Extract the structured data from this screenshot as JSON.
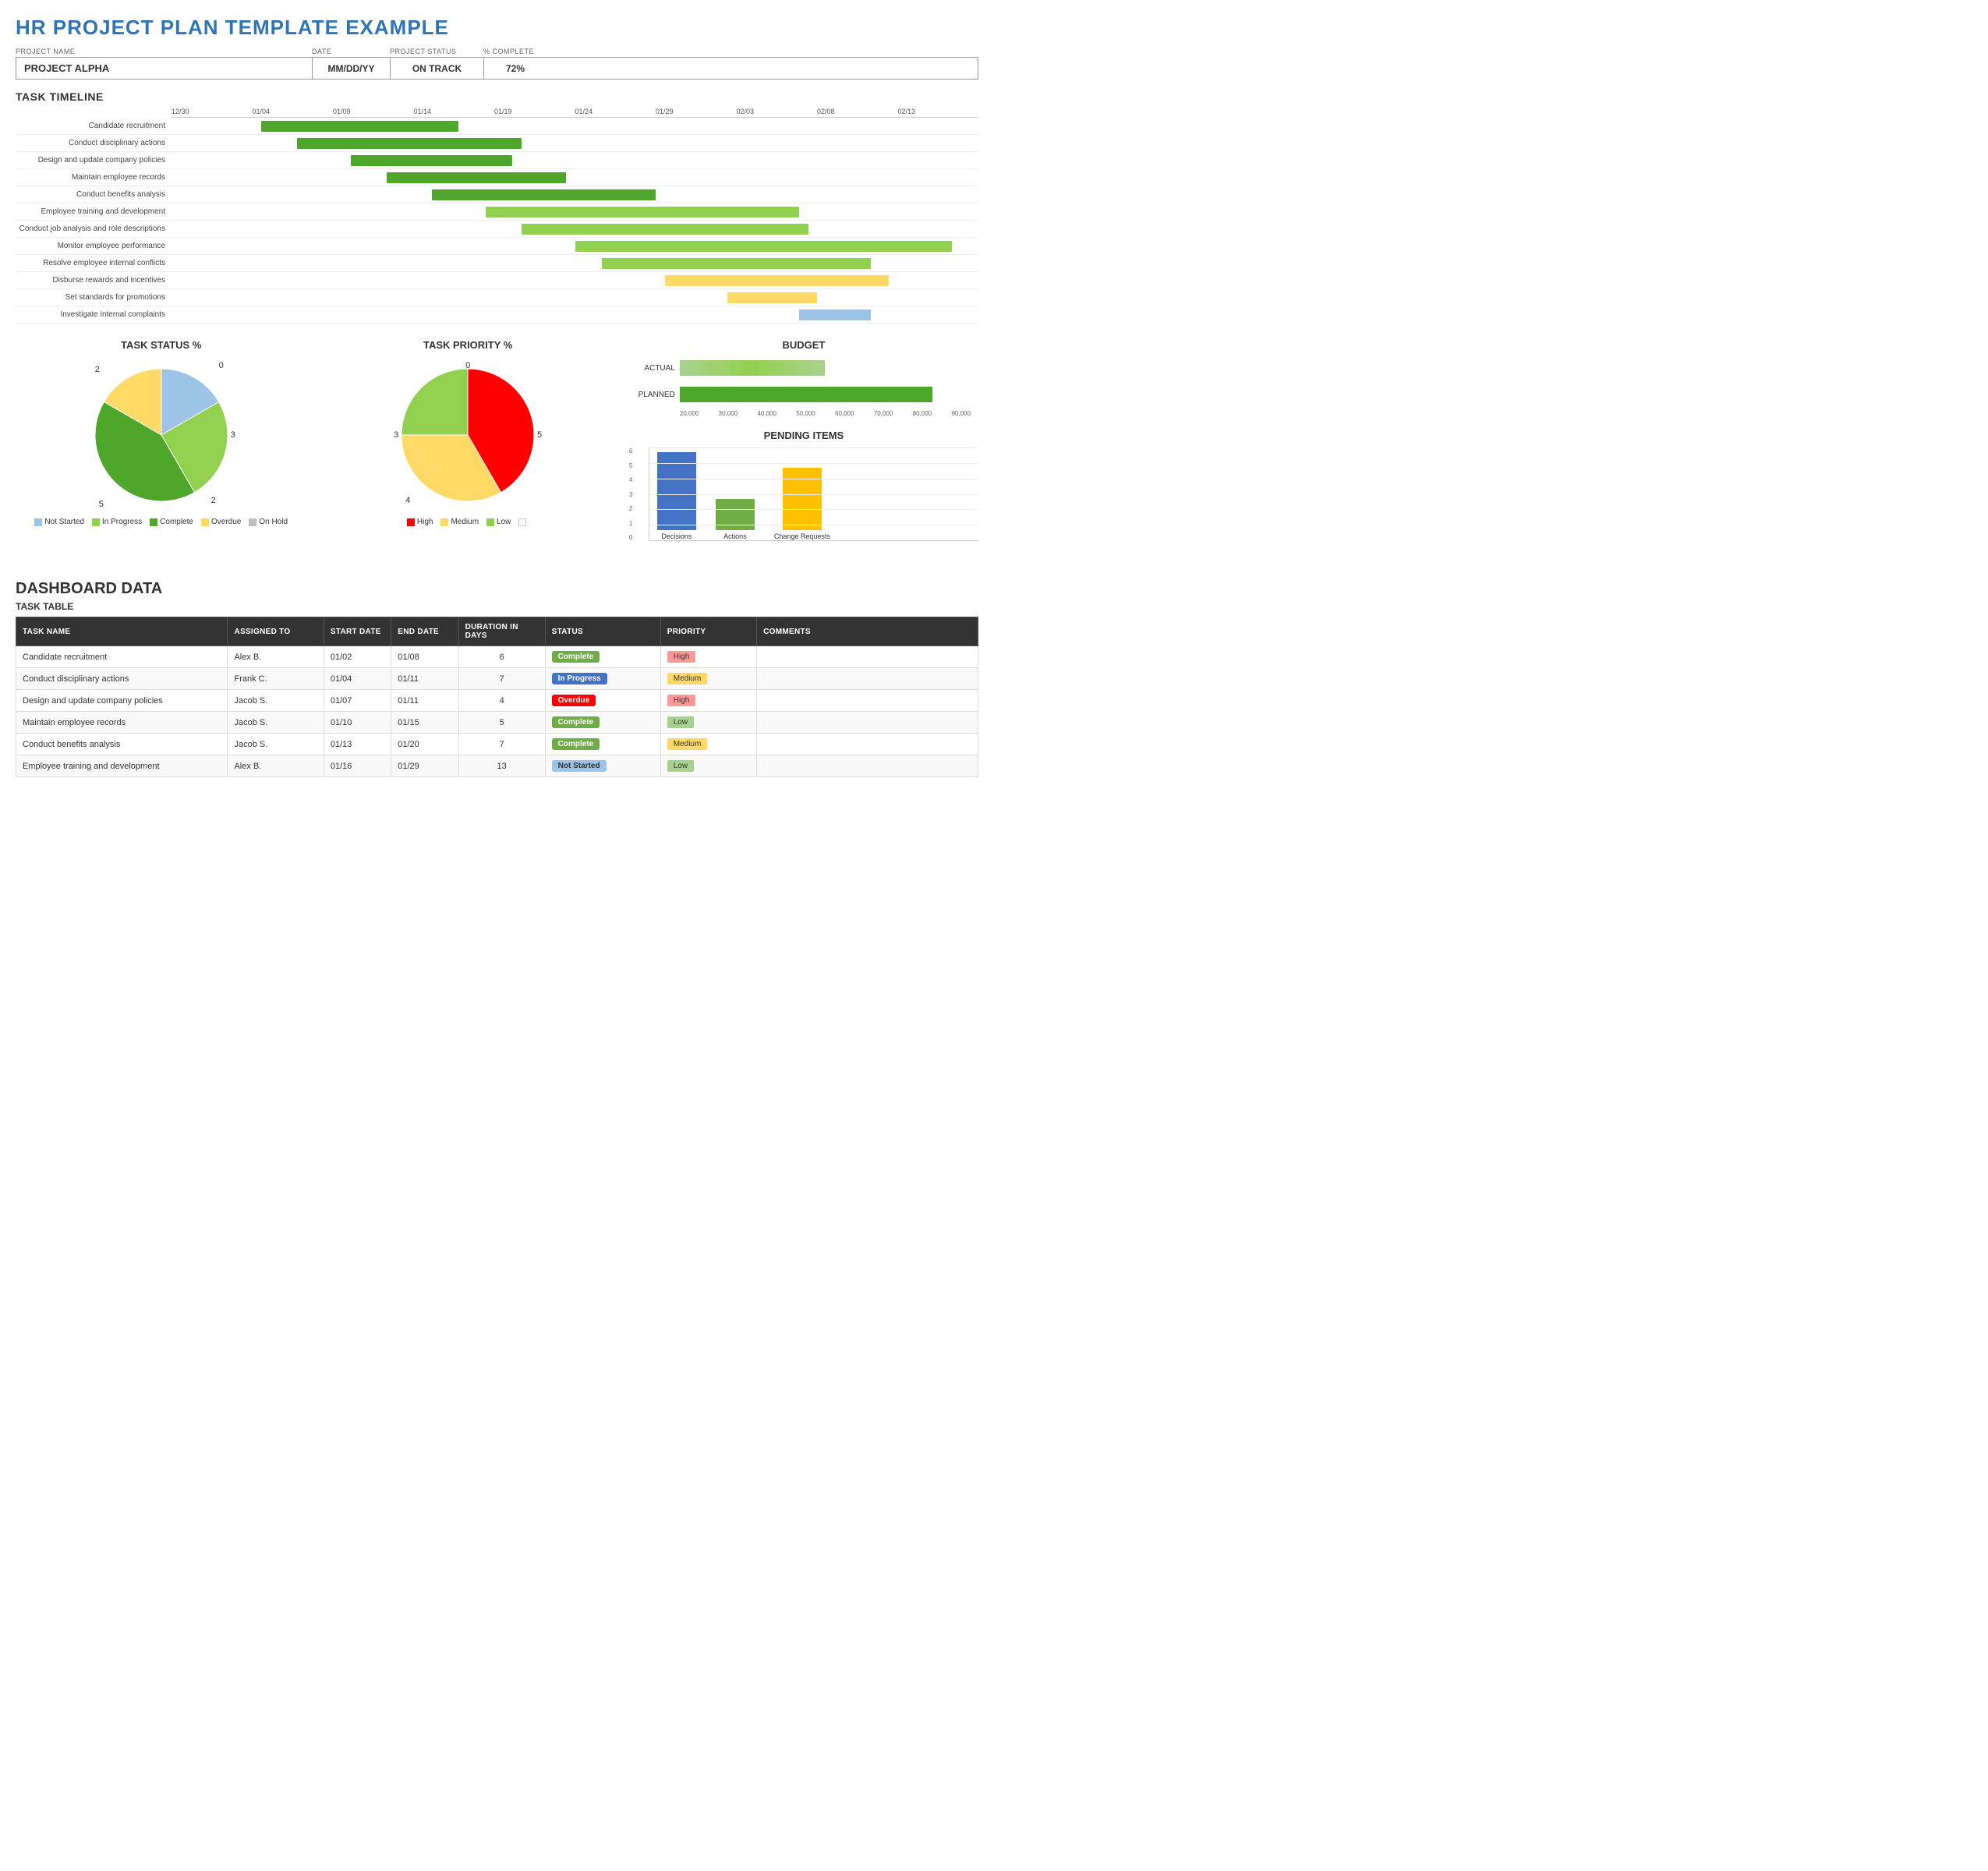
{
  "title": "HR PROJECT PLAN TEMPLATE EXAMPLE",
  "project": {
    "name_label": "PROJECT NAME",
    "date_label": "DATE",
    "status_label": "PROJECT STATUS",
    "complete_label": "% COMPLETE",
    "name_value": "PROJECT ALPHA",
    "date_value": "MM/DD/YY",
    "status_value": "ON TRACK",
    "complete_value": "72%"
  },
  "gantt": {
    "section_title": "TASK TIMELINE",
    "dates": [
      "12/30",
      "01/04",
      "01/09",
      "01/14",
      "01/19",
      "01/24",
      "01/29",
      "02/03",
      "02/08",
      "02/13"
    ],
    "tasks": [
      {
        "name": "Candidate recruitment",
        "start": 1,
        "width": 2.2,
        "color": "#4EA72A"
      },
      {
        "name": "Conduct disciplinary actions",
        "start": 1.4,
        "width": 2.5,
        "color": "#4EA72A"
      },
      {
        "name": "Design and update company policies",
        "start": 2.0,
        "width": 1.8,
        "color": "#4EA72A"
      },
      {
        "name": "Maintain employee records",
        "start": 2.4,
        "width": 2.0,
        "color": "#4EA72A"
      },
      {
        "name": "Conduct benefits analysis",
        "start": 2.9,
        "width": 2.5,
        "color": "#4EA72A"
      },
      {
        "name": "Employee training and development",
        "start": 3.5,
        "width": 3.5,
        "color": "#92D050"
      },
      {
        "name": "Conduct job analysis and role descriptions",
        "start": 3.9,
        "width": 3.2,
        "color": "#92D050"
      },
      {
        "name": "Monitor employee performance",
        "start": 4.5,
        "width": 4.2,
        "color": "#92D050"
      },
      {
        "name": "Resolve employee internal conflicts",
        "start": 4.8,
        "width": 3.0,
        "color": "#92D050"
      },
      {
        "name": "Disburse rewards and incentives",
        "start": 5.5,
        "width": 2.5,
        "color": "#FFD966"
      },
      {
        "name": "Set standards for promotions",
        "start": 6.2,
        "width": 1.0,
        "color": "#FFD966"
      },
      {
        "name": "Investigate internal complaints",
        "start": 7.0,
        "width": 0.8,
        "color": "#9DC3E6"
      }
    ]
  },
  "task_status": {
    "title": "TASK STATUS %",
    "slices": [
      {
        "label": "Not Started",
        "value": 2,
        "color": "#9DC3E6",
        "percent": 16.7
      },
      {
        "label": "In Progress",
        "value": 3,
        "color": "#92D050",
        "percent": 25
      },
      {
        "label": "Complete",
        "value": 5,
        "color": "#4EA72A",
        "percent": 41.7
      },
      {
        "label": "Overdue",
        "value": 2,
        "color": "#FFD966",
        "percent": 16.7
      },
      {
        "label": "On Hold",
        "value": 0,
        "color": "#BFBFBF",
        "percent": 0
      }
    ],
    "labels": {
      "not_started": "2",
      "in_progress": "3",
      "complete": "5",
      "overdue": "2",
      "on_hold": "0"
    }
  },
  "task_priority": {
    "title": "TASK PRIORITY %",
    "slices": [
      {
        "label": "High",
        "value": 5,
        "color": "#FF0000",
        "percent": 41.7
      },
      {
        "label": "Medium",
        "value": 4,
        "color": "#FFD966",
        "percent": 33.3
      },
      {
        "label": "Low",
        "value": 3,
        "color": "#92D050",
        "percent": 25
      },
      {
        "label": "blank",
        "value": 0,
        "color": "#FFFFFF",
        "percent": 0
      }
    ],
    "labels": {
      "high": "5",
      "medium": "4",
      "low": "3",
      "blank": "0"
    }
  },
  "budget": {
    "title": "BUDGET",
    "actual_label": "ACTUAL",
    "planned_label": "PLANNED",
    "actual_value": 45000,
    "planned_value": 78000,
    "max": 90000,
    "axis": [
      "20,000",
      "30,000",
      "40,000",
      "50,000",
      "60,000",
      "70,000",
      "80,000",
      "90,000"
    ]
  },
  "pending": {
    "title": "PENDING ITEMS",
    "items": [
      {
        "label": "Decisions",
        "value": 5,
        "color": "#4472C4"
      },
      {
        "label": "Actions",
        "value": 2,
        "color": "#70AD47"
      },
      {
        "label": "Change Requests",
        "value": 4,
        "color": "#FFC000"
      }
    ],
    "y_max": 6
  },
  "dashboard": {
    "title": "DASHBOARD DATA",
    "table_subtitle": "TASK TABLE",
    "headers": [
      "TASK NAME",
      "ASSIGNED TO",
      "START DATE",
      "END DATE",
      "DURATION in days",
      "STATUS",
      "PRIORITY",
      "COMMENTS"
    ],
    "rows": [
      {
        "task": "Candidate recruitment",
        "assigned": "Alex B.",
        "start": "01/02",
        "end": "01/08",
        "duration": "6",
        "status": "Complete",
        "status_class": "status-complete",
        "priority": "High",
        "priority_class": "priority-high",
        "comments": ""
      },
      {
        "task": "Conduct disciplinary actions",
        "assigned": "Frank C.",
        "start": "01/04",
        "end": "01/11",
        "duration": "7",
        "status": "In Progress",
        "status_class": "status-inprogress",
        "priority": "Medium",
        "priority_class": "priority-medium",
        "comments": ""
      },
      {
        "task": "Design and update company policies",
        "assigned": "Jacob S.",
        "start": "01/07",
        "end": "01/11",
        "duration": "4",
        "status": "Overdue",
        "status_class": "status-overdue",
        "priority": "High",
        "priority_class": "priority-high",
        "comments": ""
      },
      {
        "task": "Maintain employee records",
        "assigned": "Jacob S.",
        "start": "01/10",
        "end": "01/15",
        "duration": "5",
        "status": "Complete",
        "status_class": "status-complete",
        "priority": "Low",
        "priority_class": "priority-low",
        "comments": ""
      },
      {
        "task": "Conduct benefits analysis",
        "assigned": "Jacob S.",
        "start": "01/13",
        "end": "01/20",
        "duration": "7",
        "status": "Complete",
        "status_class": "status-complete",
        "priority": "Medium",
        "priority_class": "priority-medium",
        "comments": ""
      },
      {
        "task": "Employee training and development",
        "assigned": "Alex B.",
        "start": "01/16",
        "end": "01/29",
        "duration": "13",
        "status": "Not Started",
        "status_class": "status-notstarted",
        "priority": "Low",
        "priority_class": "priority-low",
        "comments": ""
      }
    ]
  }
}
